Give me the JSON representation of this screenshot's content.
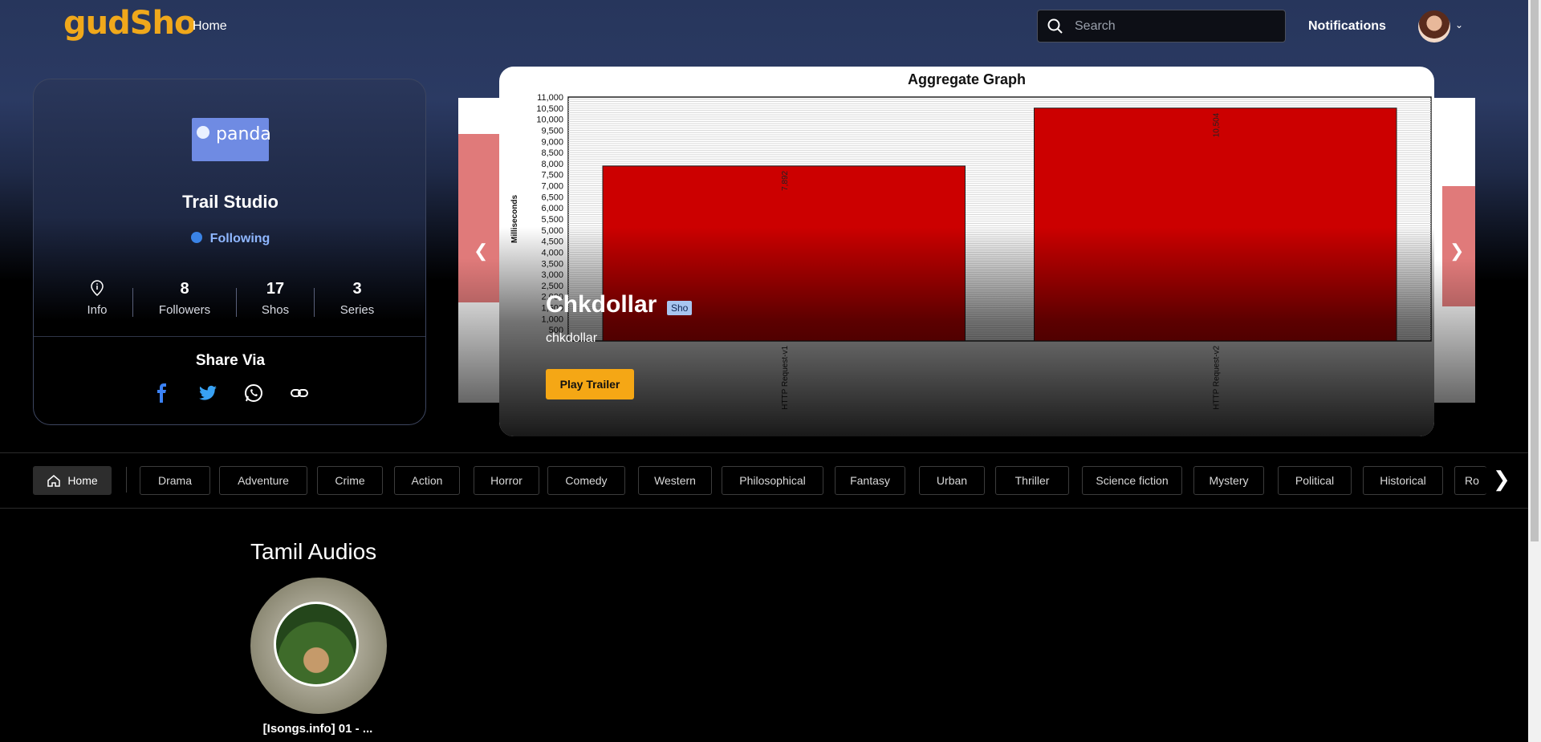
{
  "header": {
    "logo": "gudSho",
    "nav_home": "Home",
    "search_placeholder": "Search",
    "notifications": "Notifications"
  },
  "profile": {
    "brand_logo_text": "panda",
    "studio_name": "Trail Studio",
    "follow_state": "Following",
    "stats": [
      {
        "value": "",
        "label": "Info"
      },
      {
        "value": "8",
        "label": "Followers"
      },
      {
        "value": "17",
        "label": "Shos"
      },
      {
        "value": "3",
        "label": "Series"
      }
    ],
    "share_title": "Share Via"
  },
  "banner": {
    "title": "Chkdollar",
    "badge": "Sho",
    "subtitle": "chkdollar",
    "trailer_button": "Play Trailer"
  },
  "chart_data": {
    "type": "bar",
    "title": "Aggregate Graph",
    "ylabel": "Milliseconds",
    "xlabel": "",
    "categories": [
      "HTTP Request-v1",
      "HTTP Request-v2"
    ],
    "values": [
      7892,
      10504
    ],
    "value_labels": [
      "7,892",
      "10,504"
    ],
    "ylim": [
      0,
      11000
    ],
    "yticks": [
      "500",
      "1,000",
      "1,500",
      "2,000",
      "2,500",
      "3,000",
      "3,500",
      "4,000",
      "4,500",
      "5,000",
      "5,500",
      "6,000",
      "6,500",
      "7,000",
      "7,500",
      "8,000",
      "8,500",
      "9,000",
      "9,500",
      "10,000",
      "10,500",
      "11,000"
    ],
    "grid": true,
    "bar_color": "#cc0000"
  },
  "genres": {
    "home": "Home",
    "items": [
      "Drama",
      "Adventure",
      "Crime",
      "Action",
      "Horror",
      "Comedy",
      "Western",
      "Philosophical",
      "Fantasy",
      "Urban",
      "Thriller",
      "Science fiction",
      "Mystery",
      "Political",
      "Historical",
      "Ro"
    ]
  },
  "section": {
    "title": "Tamil Audios",
    "items": [
      {
        "label": "[Isongs.info] 01 - ..."
      }
    ]
  }
}
